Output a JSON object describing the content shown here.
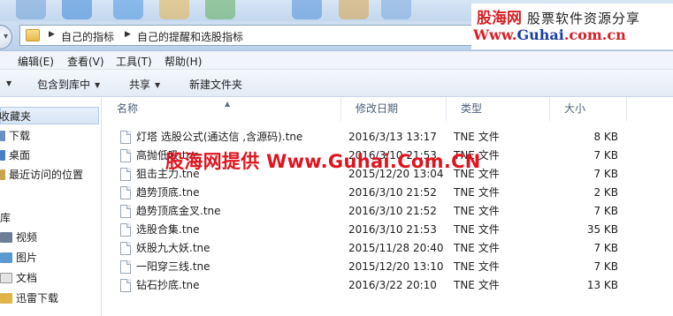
{
  "address_bar": {
    "breadcrumbs": [
      "自己的指标",
      "自己的提醒和选股指标"
    ]
  },
  "brand": {
    "name": "股海网",
    "slogan": "股票软件资源分享",
    "url_part1": "Www.",
    "url_part2": "Guhai",
    "url_part3": ".com.cn"
  },
  "menubar": {
    "items": [
      "编辑(E)",
      "查看(V)",
      "工具(T)",
      "帮助(H)"
    ]
  },
  "toolbar": {
    "include_in_library": "包含到库中",
    "share": "共享",
    "new_folder": "新建文件夹"
  },
  "nav_pane": {
    "favorites": "收藏夹",
    "favorites_items": [
      "下载",
      "桌面",
      "最近访问的位置"
    ],
    "libraries": "库",
    "library_items": [
      "视频",
      "图片",
      "文档",
      "迅雷下载"
    ]
  },
  "columns": {
    "name": "名称",
    "modified": "修改日期",
    "type": "类型",
    "size": "大小"
  },
  "files": [
    {
      "name": "灯塔 选股公式(通达信 ,含源码).tne",
      "modified": "2016/3/13 13:17",
      "type": "TNE 文件",
      "size": "8 KB"
    },
    {
      "name": "高抛低吸.tne",
      "modified": "2016/3/10 21:53",
      "type": "TNE 文件",
      "size": "7 KB"
    },
    {
      "name": "狙击主力.tne",
      "modified": "2015/12/20 13:04",
      "type": "TNE 文件",
      "size": "7 KB"
    },
    {
      "name": "趋势顶底.tne",
      "modified": "2016/3/10 21:52",
      "type": "TNE 文件",
      "size": "2 KB"
    },
    {
      "name": "趋势顶底金叉.tne",
      "modified": "2016/3/10 21:52",
      "type": "TNE 文件",
      "size": "7 KB"
    },
    {
      "name": "选股合集.tne",
      "modified": "2016/3/10 21:53",
      "type": "TNE 文件",
      "size": "35 KB"
    },
    {
      "name": "妖股九大妖.tne",
      "modified": "2015/11/28 20:40",
      "type": "TNE 文件",
      "size": "7 KB"
    },
    {
      "name": "一阳穿三线.tne",
      "modified": "2015/12/20 13:10",
      "type": "TNE 文件",
      "size": "7 KB"
    },
    {
      "name": "钻石抄底.tne",
      "modified": "2016/3/22 20:10",
      "type": "TNE 文件",
      "size": "13 KB"
    }
  ],
  "watermark": "股海网提供 Www.Guhai.Com.CN",
  "colors": {
    "brand_red": "#d81f26",
    "brand_blue": "#1b3da8",
    "watermark_red": "#e0141e",
    "chrome_blue": "#c3d7ee"
  }
}
